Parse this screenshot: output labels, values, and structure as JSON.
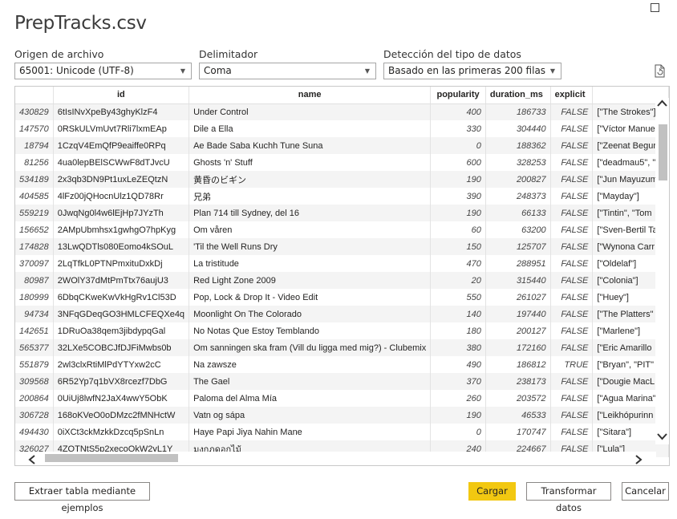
{
  "window": {
    "title": "PrepTracks.csv"
  },
  "options": {
    "origin": {
      "label": "Origen de archivo",
      "value": "65001: Unicode (UTF-8)"
    },
    "delimiter": {
      "label": "Delimitador",
      "value": "Coma"
    },
    "detection": {
      "label": "Detección del tipo de datos",
      "value": "Basado en las primeras 200 filas"
    }
  },
  "table": {
    "columns": [
      "",
      "id",
      "name",
      "popularity",
      "duration_ms",
      "explicit",
      ""
    ],
    "rows": [
      [
        "430829",
        "6tIsINvXpeBy43ghyKlzF4",
        "Under Control",
        "400",
        "186733",
        "FALSE",
        "[\"The Strokes\"]"
      ],
      [
        "147570",
        "0RSkULVmUvt7Rli7lxmEAp",
        "Dile a Ella",
        "330",
        "304440",
        "FALSE",
        "[\"Víctor Manue"
      ],
      [
        "18794",
        "1CzqV4EmQfP9eaiffe0RPq",
        "Ae Bade Saba Kuchh Tune Suna",
        "0",
        "188362",
        "FALSE",
        "[\"Zeenat Begur"
      ],
      [
        "81256",
        "4ua0lepBElSCWwF8dTJvcU",
        "Ghosts 'n' Stuff",
        "600",
        "328253",
        "FALSE",
        "[\"deadmau5\", \""
      ],
      [
        "534189",
        "2x3qb3DN9Pt1uxLeZEQtzN",
        "黄昏のビギン",
        "190",
        "200827",
        "FALSE",
        "[\"Jun Mayuzum"
      ],
      [
        "404585",
        "4lFz00jQHocnUlz1QD78Rr",
        "兄弟",
        "390",
        "248373",
        "FALSE",
        "[\"Mayday\"]"
      ],
      [
        "559219",
        "0JwqNg0l4w6lEjHp7JYzTh",
        "Plan 714 till Sydney, del 16",
        "190",
        "66133",
        "FALSE",
        "[\"Tintin\", \"Tom"
      ],
      [
        "156652",
        "2AMpUbmhsx1gwhgO7hpKyg",
        "Om våren",
        "60",
        "63200",
        "FALSE",
        "[\"Sven-Bertil Ta"
      ],
      [
        "174828",
        "13LwQDTls080Eomo4kSOuL",
        "'Til the Well Runs Dry",
        "150",
        "125707",
        "FALSE",
        "[\"Wynona Carr"
      ],
      [
        "370097",
        "2LqTfkL0PTNPmxituDxkDj",
        "La tristitude",
        "470",
        "288951",
        "FALSE",
        "[\"Oldelaf\"]"
      ],
      [
        "80987",
        "2WOlY37dMtPmTtx76aujU3",
        "Red Light Zone 2009",
        "20",
        "315440",
        "FALSE",
        "[\"Colonia\"]"
      ],
      [
        "180999",
        "6DbqCKweKwVkHgRv1Cl53D",
        "Pop, Lock & Drop It - Video Edit",
        "550",
        "261027",
        "FALSE",
        "[\"Huey\"]"
      ],
      [
        "94734",
        "3NFqGDeqGO3HMLCFEQXe4q",
        "Moonlight On The Colorado",
        "140",
        "197440",
        "FALSE",
        "[\"The Platters\""
      ],
      [
        "142651",
        "1DRuOa38qem3jibdypqGal",
        "No Notas Que Estoy Temblando",
        "180",
        "200127",
        "FALSE",
        "[\"Marlene\"]"
      ],
      [
        "565377",
        "32LXe5COBCJfDJFiMwbs0b",
        "Om sanningen ska fram (Vill du ligga med mig?) - Clubemix",
        "380",
        "172160",
        "FALSE",
        "[\"Eric Amarillo"
      ],
      [
        "551879",
        "2wl3clxRtiMlPdYTYxw2cC",
        "Na zawsze",
        "490",
        "186812",
        "TRUE",
        "[\"Bryan\", \"PIT\""
      ],
      [
        "309568",
        "6R52Yp7q1bVX8rcezf7DbG",
        "The Gael",
        "370",
        "238173",
        "FALSE",
        "[\"Dougie MacL"
      ],
      [
        "200864",
        "0UiUj8lwfN2JaX4wwY5ObK",
        "Paloma del Alma Mía",
        "260",
        "203572",
        "FALSE",
        "[\"Agua Marina\""
      ],
      [
        "306728",
        "168oKVeO0oDMzc2fMNHctW",
        "Vatn og sápa",
        "190",
        "46533",
        "FALSE",
        "[\"Leikhópurinn"
      ],
      [
        "494430",
        "0iXCt3ckMzkkDzcq5pSnLn",
        "Haye Papi Jiya Nahin Mane",
        "0",
        "170747",
        "FALSE",
        "[\"Sitara\"]"
      ],
      [
        "326027",
        "4ZQTNtS5p2xecoOkW2yL1Y",
        "มงกุฎดอกไม้",
        "240",
        "224667",
        "FALSE",
        "[\"Lula\"]"
      ]
    ]
  },
  "buttons": {
    "extract": "Extraer tabla mediante ejemplos",
    "load": "Cargar",
    "transform": "Transformar datos",
    "cancel": "Cancelar"
  },
  "icons": {
    "maximize": "maximize-icon",
    "refresh": "refresh-file-icon",
    "dropdown": "chevron-down-icon",
    "scroll_up": "chevron-up-icon",
    "scroll_down": "chevron-down-icon",
    "scroll_left": "chevron-left-icon",
    "scroll_right": "chevron-right-icon"
  },
  "colors": {
    "primary_button": "#f2c811",
    "odd_row": "#f4f4f4",
    "border": "#c8c8c8"
  }
}
